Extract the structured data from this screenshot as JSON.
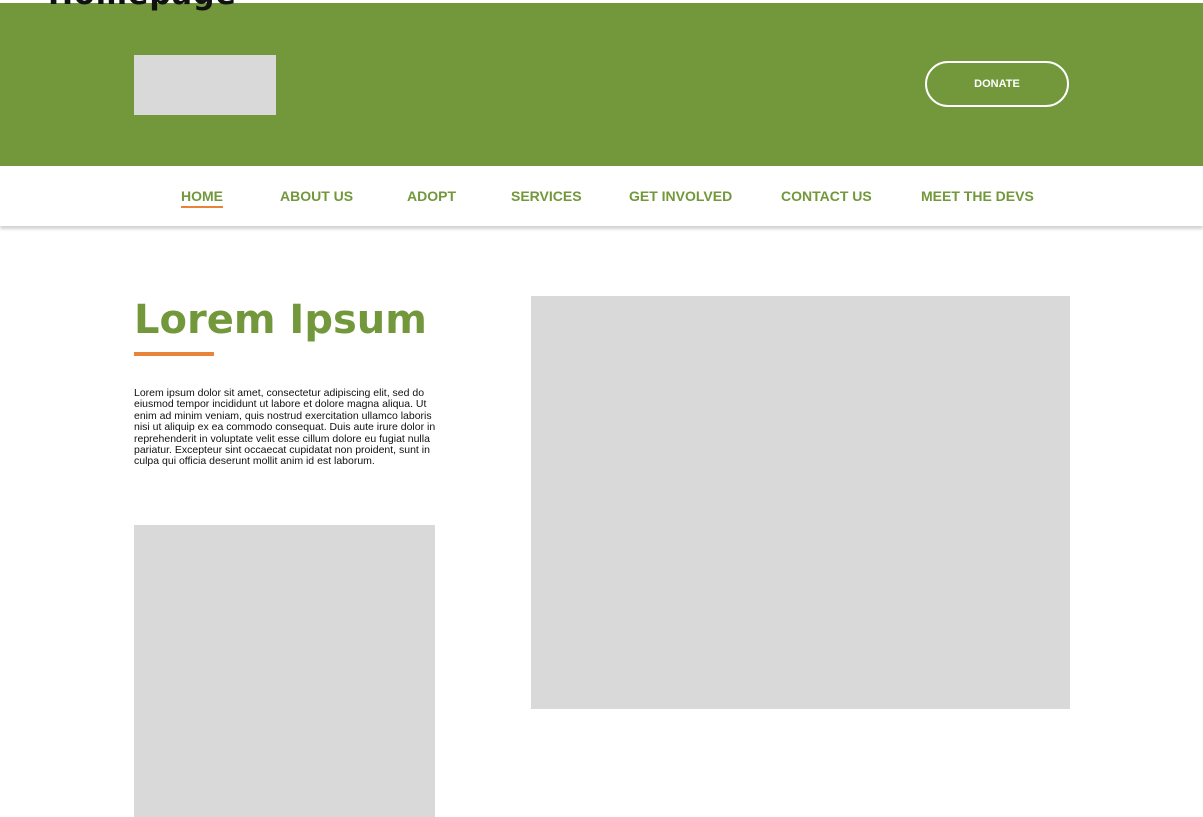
{
  "frame": {
    "title": "Homepage"
  },
  "header": {
    "bg_color": "#72983b",
    "donate_label": "DONATE"
  },
  "nav": {
    "accent_color": "#e8843a",
    "items": [
      {
        "label": "HOME",
        "active": true
      },
      {
        "label": "ABOUT US",
        "active": false
      },
      {
        "label": "ADOPT",
        "active": false
      },
      {
        "label": "SERVICES",
        "active": false
      },
      {
        "label": "GET INVOLVED",
        "active": false
      },
      {
        "label": "CONTACT US",
        "active": false
      },
      {
        "label": "MEET THE DEVS",
        "active": false
      }
    ]
  },
  "main": {
    "title": "Lorem Ipsum",
    "body": "Lorem ipsum dolor sit amet, consectetur adipiscing elit, sed do eiusmod tempor incididunt ut labore et dolore magna aliqua. Ut enim ad minim veniam, quis nostrud exercitation ullamco laboris nisi ut aliquip ex ea commodo consequat. Duis aute irure dolor in reprehenderit in voluptate velit esse cillum dolore eu fugiat nulla pariatur. Excepteur sint occaecat cupidatat non proident, sunt in culpa qui officia deserunt mollit anim id est laborum."
  }
}
